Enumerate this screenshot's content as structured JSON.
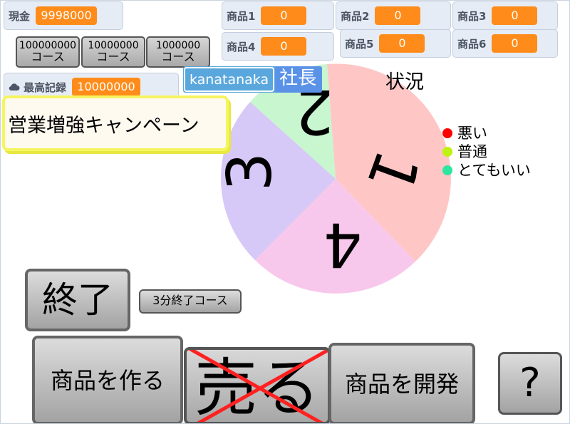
{
  "monitors": {
    "cash": {
      "label": "現金",
      "value": "9998000"
    },
    "record": {
      "label": "最高記録",
      "value": "10000000"
    },
    "products": [
      {
        "label": "商品1",
        "value": "0"
      },
      {
        "label": "商品2",
        "value": "0"
      },
      {
        "label": "商品3",
        "value": "0"
      },
      {
        "label": "商品4",
        "value": "0"
      },
      {
        "label": "商品5",
        "value": "0"
      },
      {
        "label": "商品6",
        "value": "0"
      }
    ]
  },
  "courses": [
    {
      "amount": "100000000",
      "suffix": "コース"
    },
    {
      "amount": "10000000",
      "suffix": "コース"
    },
    {
      "amount": "1000000",
      "suffix": "コース"
    }
  ],
  "campaign": "営業増強キャンペーン",
  "user": {
    "name": "kanatanaka",
    "title": "社長"
  },
  "status_title": "況",
  "status_title_partial": "状況",
  "wheel": {
    "segments": [
      {
        "label": "1",
        "color": "#ffc6c6"
      },
      {
        "label": "2",
        "color": "#c8f6cf"
      },
      {
        "label": "3",
        "color": "#d6c8f7"
      },
      {
        "label": "4",
        "color": "#f8c8ec"
      }
    ]
  },
  "legend": [
    {
      "label": "悪い",
      "color": "#ff0000"
    },
    {
      "label": "普通",
      "color": "#bff20e"
    },
    {
      "label": "とてもいい",
      "color": "#2ee6a0"
    }
  ],
  "buttons": {
    "end": "終了",
    "quick_end": "3分終了コース",
    "make": "商品を作る",
    "sell": "売る",
    "develop": "商品を開発",
    "help": "?"
  },
  "colors": {
    "monitor_value": "#ff8c1a",
    "sell_cross": "#ff2020",
    "user_tag": "#5aa7dd"
  }
}
